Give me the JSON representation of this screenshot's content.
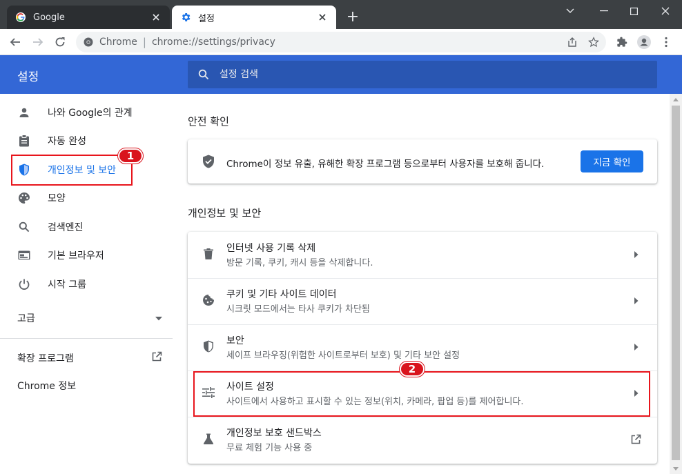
{
  "tabs": [
    {
      "title": "Google",
      "icon": "google-icon",
      "active": false
    },
    {
      "title": "설정",
      "icon": "gear-icon",
      "active": true
    }
  ],
  "toolbar": {
    "site_name": "Chrome",
    "url": "chrome://settings/privacy"
  },
  "header": {
    "title": "설정",
    "search_placeholder": "설정 검색"
  },
  "sidebar": {
    "items": [
      {
        "label": "나와 Google의 관계",
        "icon": "person-icon"
      },
      {
        "label": "자동 완성",
        "icon": "clipboard-icon"
      },
      {
        "label": "개인정보 및 보안",
        "icon": "shield-icon",
        "active": true
      },
      {
        "label": "모양",
        "icon": "palette-icon"
      },
      {
        "label": "검색엔진",
        "icon": "search-icon"
      },
      {
        "label": "기본 브라우저",
        "icon": "browser-icon"
      },
      {
        "label": "시작 그룹",
        "icon": "power-icon"
      }
    ],
    "advanced": "고급",
    "extensions": "확장 프로그램",
    "about": "Chrome 정보"
  },
  "safety": {
    "section_title": "안전 확인",
    "text": "Chrome이 정보 유출, 유해한 확장 프로그램 등으로부터 사용자를 보호해 줍니다.",
    "button": "지금 확인"
  },
  "privacy": {
    "section_title": "개인정보 및 보안",
    "rows": [
      {
        "title": "인터넷 사용 기록 삭제",
        "subtitle": "방문 기록, 쿠키, 캐시 등을 삭제합니다.",
        "icon": "trash-icon",
        "action": "arrow"
      },
      {
        "title": "쿠키 및 기타 사이트 데이터",
        "subtitle": "시크릿 모드에서는 타사 쿠키가 차단됨",
        "icon": "cookie-icon",
        "action": "arrow"
      },
      {
        "title": "보안",
        "subtitle": "세이프 브라우징(위험한 사이트로부터 보호) 및 기타 보안 설정",
        "icon": "shield-icon",
        "action": "arrow"
      },
      {
        "title": "사이트 설정",
        "subtitle": "사이트에서 사용하고 표시할 수 있는 정보(위치, 카메라, 팝업 등)를 제어합니다.",
        "icon": "tune-icon",
        "action": "arrow"
      },
      {
        "title": "개인정보 보호 샌드박스",
        "subtitle": "무료 체험 기능 사용 중",
        "icon": "flask-icon",
        "action": "external"
      }
    ]
  },
  "annotations": {
    "badge1": "1",
    "badge2": "2"
  },
  "colors": {
    "header_blue": "#3367d6",
    "accent_blue": "#1a73e8",
    "annotation_red": "#e8151c"
  }
}
